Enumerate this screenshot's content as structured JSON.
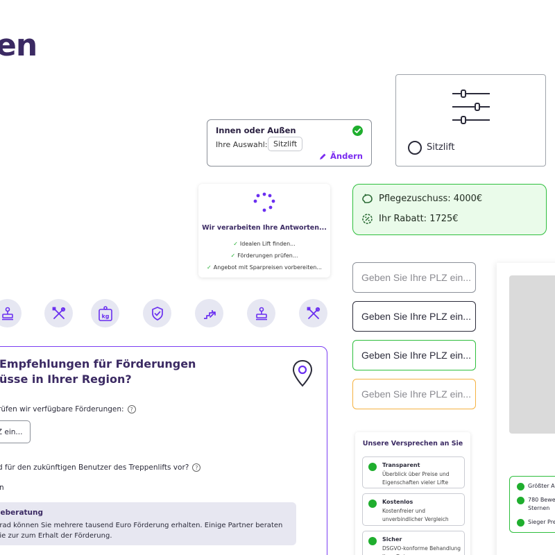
{
  "brand": {
    "text": "en"
  },
  "choice_card": {
    "title": "Innen oder Außen",
    "selection_label": "Ihre Auswahl:",
    "selection_value": "Sitzlift",
    "edit_label": "Ändern"
  },
  "filter_card": {
    "option_label": "Sitzlift"
  },
  "process_card": {
    "title": "Wir verarbeiten Ihre Antworten...",
    "steps": [
      "Idealen Lift finden...",
      "Förderungen prüfen...",
      "Angebot mit Sparpreisen vorbereiten..."
    ]
  },
  "savings": {
    "subsidy": "Pflegezuschuss: 4000€",
    "discount": "Ihr Rabatt: 1725€",
    "accent": "#2dbe3c"
  },
  "plz_inputs": [
    {
      "state": "default",
      "placeholder": "Geben Sie Ihre PLZ ein..."
    },
    {
      "state": "active",
      "placeholder": "Geben Sie Ihre PLZ ein..."
    },
    {
      "state": "valid",
      "placeholder": "Geben Sie Ihre PLZ ein..."
    },
    {
      "state": "warning",
      "placeholder": "Geben Sie Ihre PLZ ein..."
    }
  ],
  "icons": [
    "stamp-icon",
    "tools-icon",
    "weight-kg-icon",
    "shield-check-icon",
    "stairs-icon",
    "stamp-icon",
    "tools-icon"
  ],
  "form": {
    "heading_line1": "Empfehlungen für Förderungen",
    "heading_line2": "üsse in Ihrer Region?",
    "question1": "rüfen wir verfügbare Förderungen:",
    "input_value": "LZ ein...",
    "question2": "d für den zukünftigen Benutzer des Treppenlifts vor?",
    "answer": "n",
    "info_title": "geberatung",
    "info_body": "grad können Sie mehrere tausend Euro Förderung erhalten. Einige Partner beraten Sie zur zum Erhalt der Förderung.",
    "accent": "#7a3cf2"
  },
  "promises": {
    "title": "Unsere Versprechen an Sie",
    "items": [
      {
        "title": "Transparent",
        "desc": "Überblick über Preise und Eigenschaften vieler Lifte"
      },
      {
        "title": "Kostenlos",
        "desc": "Kostenfreier und unverbindlicher Vergleich"
      },
      {
        "title": "Sicher",
        "desc": "DSGVO-konforme Behandlung Ihrer Daten"
      }
    ]
  },
  "right_badges": [
    {
      "text": "Größter A"
    },
    {
      "text": "780 Bewer Sternen"
    },
    {
      "text": "Sieger Pre"
    }
  ]
}
